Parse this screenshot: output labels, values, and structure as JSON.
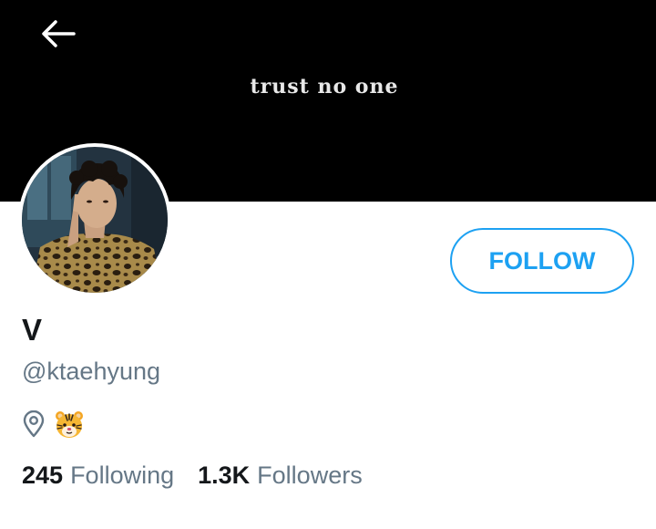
{
  "header": {
    "banner_text": "trust no one",
    "back_icon": "arrow-left-icon"
  },
  "profile": {
    "display_name": "V",
    "handle": "@ktaehyung",
    "location_icon": "location-pin-icon",
    "location_emoji": "tiger-face-emoji",
    "follow_label": "FOLLOW"
  },
  "stats": {
    "following_count": "245",
    "following_label": "Following",
    "followers_count": "1.3K",
    "followers_label": "Followers"
  },
  "colors": {
    "accent": "#1da1f2",
    "banner": "#000000",
    "secondary_text": "#657786",
    "primary_text": "#14171a"
  }
}
